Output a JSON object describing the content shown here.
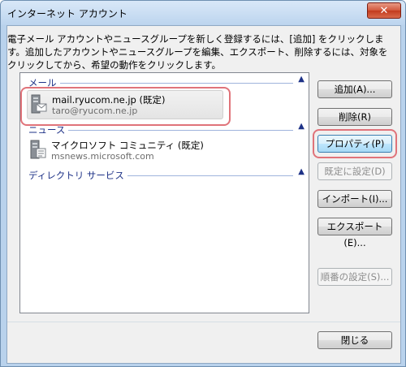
{
  "window": {
    "title": "インターネット アカウント"
  },
  "instructions": "電子メール アカウントやニュースグループを新しく登録するには、[追加] をクリックします。追加したアカウントやニュースグループを編集、エクスポート、削除するには、対象をクリックしてから、希望の動作をクリックします。",
  "groups": [
    {
      "label": "メール",
      "items": [
        {
          "name": "mail.ryucom.ne.jp (既定)",
          "sub": "taro@ryucom.ne.jp",
          "selected": true
        }
      ]
    },
    {
      "label": "ニュース",
      "items": [
        {
          "name": "マイクロソフト コミュニティ (既定)",
          "sub": "msnews.microsoft.com",
          "selected": false
        }
      ]
    },
    {
      "label": "ディレクトリ サービス",
      "items": []
    }
  ],
  "buttons": {
    "add": "追加(A)...",
    "delete": "削除(R)",
    "properties": "プロパティ(P)",
    "set_default": "既定に設定(D)",
    "import": "インポート(I)...",
    "export": "エクスポート(E)...",
    "order": "順番の設定(S)...",
    "close": "閉じる"
  },
  "icons": {
    "close": "close-icon",
    "expand": "chevron-up-icon",
    "mail_account": "mail-account-icon",
    "news_account": "news-server-icon"
  },
  "colors": {
    "group_header": "#1e3287",
    "annotation": "#e0737a",
    "titlebar": "#c9def3"
  }
}
